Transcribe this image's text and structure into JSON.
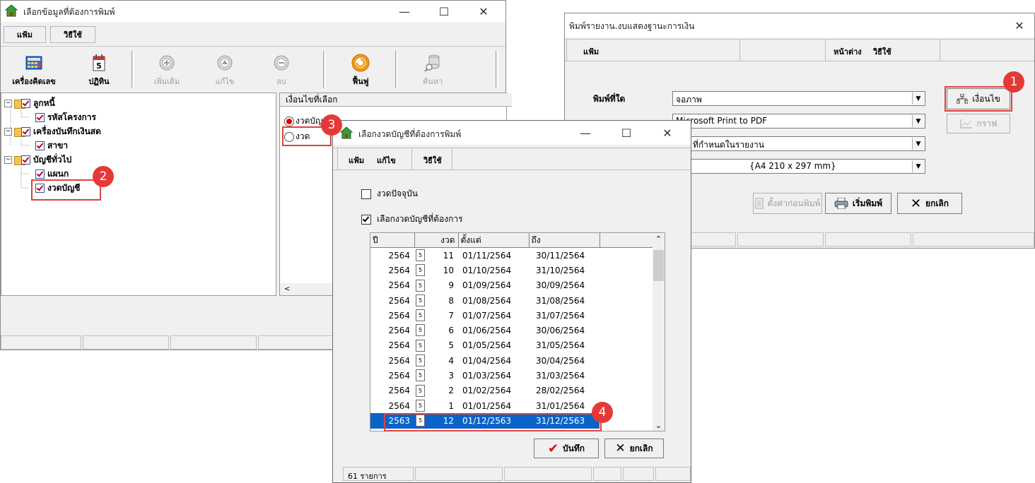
{
  "win1": {
    "title": "เลือกข้อมูลที่ต้องการพิมพ์",
    "menu": [
      "แฟ้ม",
      "วิธีใช้"
    ],
    "toolbar": [
      {
        "label": "เครื่องคิดเลข",
        "icon": "calculator-icon",
        "enabled": true
      },
      {
        "label": "ปฏิทิน",
        "icon": "calendar-icon",
        "enabled": true
      },
      {
        "label": "เพิ่มเติม",
        "icon": "add-circle-icon",
        "enabled": false
      },
      {
        "label": "แก้ไข",
        "icon": "edit-circle-icon",
        "enabled": false
      },
      {
        "label": "ลบ",
        "icon": "delete-circle-icon",
        "enabled": false
      },
      {
        "label": "ฟื้นฟู",
        "icon": "refresh-icon",
        "enabled": true
      },
      {
        "label": "ค้นหา",
        "icon": "search-db-icon",
        "enabled": false
      }
    ],
    "tree": [
      {
        "label": "ลูกหนี้",
        "level": 0
      },
      {
        "label": "รหัสโครงการ",
        "level": 1
      },
      {
        "label": "เครื่องบันทึกเงินสด",
        "level": 0
      },
      {
        "label": "สาขา",
        "level": 1
      },
      {
        "label": "บัญชีทั่วไป",
        "level": 0
      },
      {
        "label": "แผนก",
        "level": 1
      },
      {
        "label": "งวดบัญชี",
        "level": 1
      }
    ],
    "condition_header": "เงื่อนไขที่เลือก",
    "condition_radio1": "งวดบัญ",
    "condition_radio2": "งวด"
  },
  "win2": {
    "title": "พิมพ์รายงาน.งบแสดงฐานะการเงิน",
    "menu_left": "แฟ้ม",
    "menu_right": [
      "หน้าต่าง",
      "วิธีใช้"
    ],
    "print_to_label": "พิมพ์ที่ใด",
    "print_to_value": "จอภาพ",
    "printer_value": "Microsoft Print to PDF",
    "combo3_value": "ที่กำหนดในรายงาน",
    "paper_value": "{A4 210 x 297 mm}",
    "condition_button": "เงื่อนไข",
    "graph_button": "กราฟ",
    "settings_button": "ตั้งค่าก่อนพิมพ์",
    "print_button": "เริ่มพิมพ์",
    "cancel_button": "ยกเลิก"
  },
  "win3": {
    "title": "เลือกงวดบัญชีที่ต้องการพิมพ์",
    "menu": [
      "แฟ้ม",
      "แก้ไข",
      "วิธีใช้"
    ],
    "check_current": "งวดปัจจุบัน",
    "check_select": "เลือกงวดบัญชีที่ต้องการ",
    "columns": [
      "ปี",
      "งวด",
      "ตั้งแต่",
      "ถึง"
    ],
    "rows": [
      {
        "year": "2564",
        "period": "11",
        "from": "01/11/2564",
        "to": "30/11/2564"
      },
      {
        "year": "2564",
        "period": "10",
        "from": "01/10/2564",
        "to": "31/10/2564"
      },
      {
        "year": "2564",
        "period": "9",
        "from": "01/09/2564",
        "to": "30/09/2564"
      },
      {
        "year": "2564",
        "period": "8",
        "from": "01/08/2564",
        "to": "31/08/2564"
      },
      {
        "year": "2564",
        "period": "7",
        "from": "01/07/2564",
        "to": "31/07/2564"
      },
      {
        "year": "2564",
        "period": "6",
        "from": "01/06/2564",
        "to": "30/06/2564"
      },
      {
        "year": "2564",
        "period": "5",
        "from": "01/05/2564",
        "to": "31/05/2564"
      },
      {
        "year": "2564",
        "period": "4",
        "from": "01/04/2564",
        "to": "30/04/2564"
      },
      {
        "year": "2564",
        "period": "3",
        "from": "01/03/2564",
        "to": "31/03/2564"
      },
      {
        "year": "2564",
        "period": "2",
        "from": "01/02/2564",
        "to": "28/02/2564"
      },
      {
        "year": "2564",
        "period": "1",
        "from": "01/01/2564",
        "to": "31/01/2564"
      },
      {
        "year": "2563",
        "period": "12",
        "from": "01/12/2563",
        "to": "31/12/2563"
      }
    ],
    "save_button": "บันทึก",
    "cancel_button": "ยกเลิก",
    "status_count": "61 รายการ"
  },
  "badges": [
    "1",
    "2",
    "3",
    "4"
  ],
  "colors": {
    "selection": "#0a64c8",
    "highlight": "#e0413b",
    "badge": "#e43a37"
  }
}
